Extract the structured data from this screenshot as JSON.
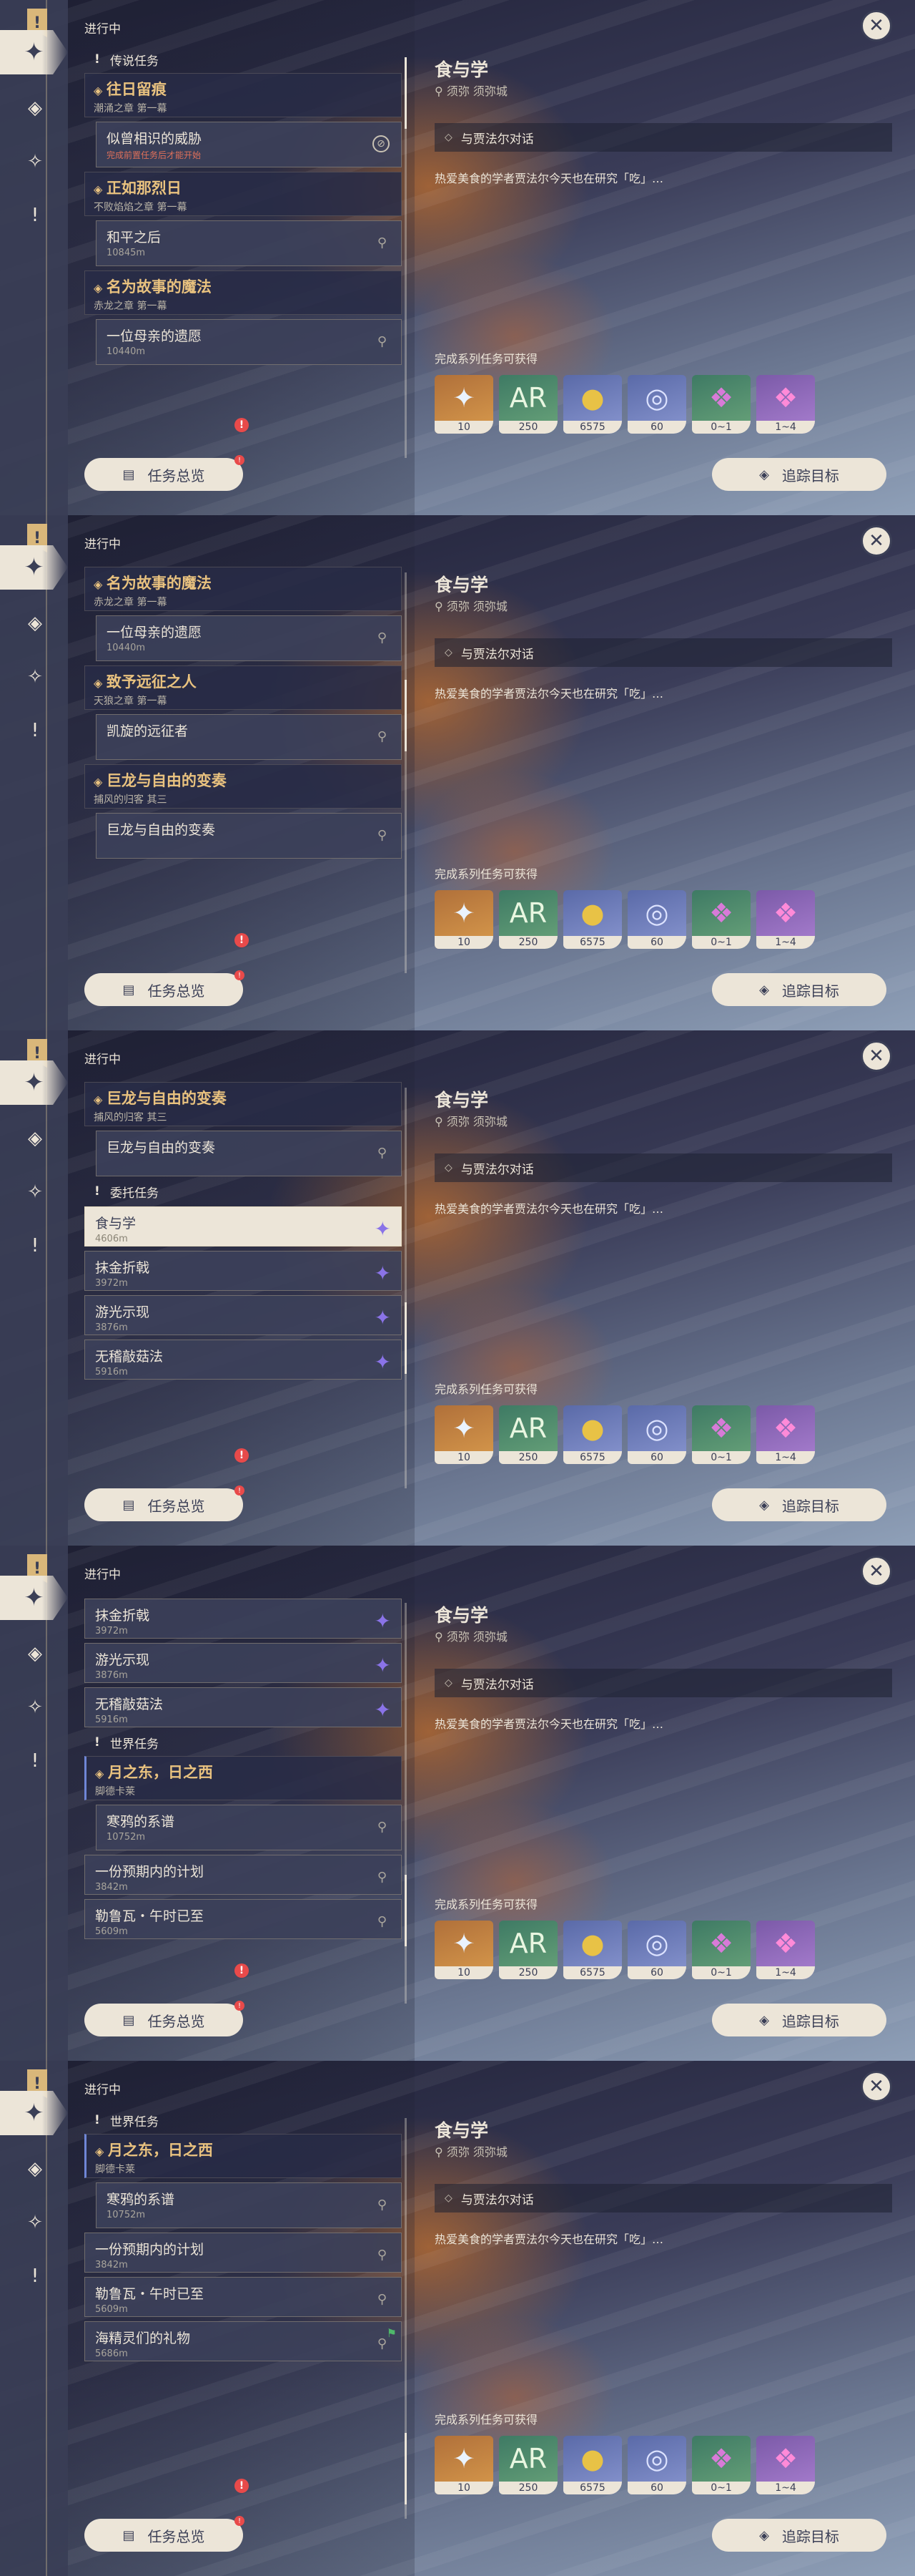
{
  "common": {
    "progress_label": "进行中",
    "close_symbol": "✕",
    "overview_label": "任务总览",
    "track_label": "追踪目标",
    "detail": {
      "title": "食与学",
      "location": "须弥 须弥城",
      "objective": "与贾法尔对话",
      "description": "热爱美食的学者贾法尔今天也在研究「吃」…",
      "rewards_title": "完成系列任务可获得",
      "rewards": [
        {
          "icon": "primogem-icon",
          "count": "10"
        },
        {
          "icon": "adventure-exp-icon",
          "count": "250"
        },
        {
          "icon": "mora-icon",
          "count": "6575"
        },
        {
          "icon": "fetters-exp-icon",
          "count": "60"
        },
        {
          "icon": "green-crystal-icon",
          "count": "0~1"
        },
        {
          "icon": "purple-crystal-icon",
          "count": "1~4"
        }
      ]
    }
  },
  "screens": [
    {
      "items": [
        {
          "type": "section",
          "label": "传说任务"
        },
        {
          "type": "chain",
          "title": "往日留痕",
          "sub": "潮涌之章 第一幕"
        },
        {
          "type": "quest",
          "name": "似曾相识的威胁",
          "warn": "完成前置任务后才能开始",
          "marker": "⊘"
        },
        {
          "type": "chain",
          "title": "正如那烈日",
          "sub": "不败焰焰之章 第一幕"
        },
        {
          "type": "quest",
          "name": "和平之后",
          "dist": "10845m",
          "marker": "pin"
        },
        {
          "type": "chain",
          "title": "名为故事的魔法",
          "sub": "赤龙之章 第一幕"
        },
        {
          "type": "quest",
          "name": "一位母亲的遗愿",
          "dist": "10440m",
          "marker": "pin"
        }
      ]
    },
    {
      "items": [
        {
          "type": "chain",
          "title": "名为故事的魔法",
          "sub": "赤龙之章 第一幕"
        },
        {
          "type": "quest",
          "name": "一位母亲的遗愿",
          "dist": "10440m",
          "marker": "pin"
        },
        {
          "type": "chain",
          "title": "致予远征之人",
          "sub": "天狼之章 第一幕"
        },
        {
          "type": "quest",
          "name": "凯旋的远征者",
          "dist": "",
          "marker": "pin"
        },
        {
          "type": "chain",
          "title": "巨龙与自由的变奏",
          "sub": "捕风的归客 其三"
        },
        {
          "type": "quest",
          "name": "巨龙与自由的变奏",
          "dist": "",
          "marker": "pin"
        }
      ]
    },
    {
      "items": [
        {
          "type": "chain",
          "title": "巨龙与自由的变奏",
          "sub": "捕风的归客 其三"
        },
        {
          "type": "quest",
          "name": "巨龙与自由的变奏",
          "dist": "",
          "marker": "pin"
        },
        {
          "type": "section",
          "label": "委托任务"
        },
        {
          "type": "flat",
          "name": "食与学",
          "dist": "4606m",
          "marker": "star",
          "selected": true
        },
        {
          "type": "flat",
          "name": "抹金折戟",
          "dist": "3972m",
          "marker": "star"
        },
        {
          "type": "flat",
          "name": "游光示现",
          "dist": "3876m",
          "marker": "star"
        },
        {
          "type": "flat",
          "name": "无稽敲菇法",
          "dist": "5916m",
          "marker": "star"
        }
      ]
    },
    {
      "items": [
        {
          "type": "flat",
          "name": "抹金折戟",
          "dist": "3972m",
          "marker": "star"
        },
        {
          "type": "flat",
          "name": "游光示现",
          "dist": "3876m",
          "marker": "star"
        },
        {
          "type": "flat",
          "name": "无稽敲菇法",
          "dist": "5916m",
          "marker": "star"
        },
        {
          "type": "section",
          "label": "世界任务"
        },
        {
          "type": "chain",
          "title": "月之东，日之西",
          "sub": "脚德卡莱",
          "hl": true
        },
        {
          "type": "quest",
          "name": "寒鸦的系谱",
          "dist": "10752m",
          "marker": "pin"
        },
        {
          "type": "flat",
          "name": "一份预期内的计划",
          "dist": "3842m",
          "marker": "pin"
        },
        {
          "type": "flat",
          "name": "勒鲁瓦・午时已至",
          "dist": "5609m",
          "marker": "pin"
        }
      ]
    },
    {
      "items": [
        {
          "type": "section",
          "label": "世界任务"
        },
        {
          "type": "chain",
          "title": "月之东，日之西",
          "sub": "脚德卡莱",
          "hl": true
        },
        {
          "type": "quest",
          "name": "寒鸦的系谱",
          "dist": "10752m",
          "marker": "pin"
        },
        {
          "type": "flat",
          "name": "一份预期内的计划",
          "dist": "3842m",
          "marker": "pin"
        },
        {
          "type": "flat",
          "name": "勒鲁瓦・午时已至",
          "dist": "5609m",
          "marker": "pin"
        },
        {
          "type": "flat",
          "name": "海精灵们的礼物",
          "dist": "5686m",
          "marker": "pin",
          "flag": true
        }
      ]
    }
  ]
}
